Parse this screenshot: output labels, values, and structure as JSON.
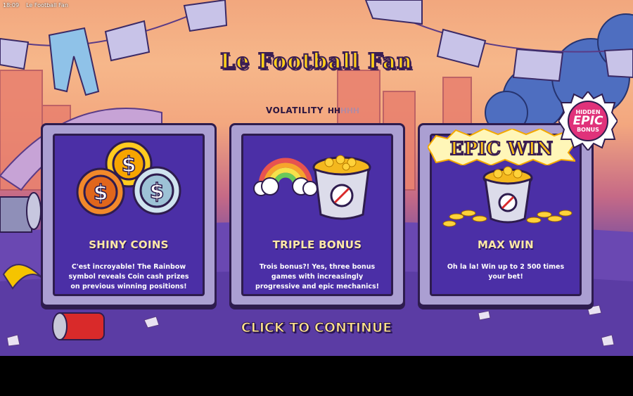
{
  "window": {
    "clock": "18:09",
    "title": "Le Football Fan"
  },
  "game": {
    "title": "Le Football Fan"
  },
  "volatility": {
    "label": "VOLATILITY",
    "level": 2,
    "max": 5,
    "icon": "H"
  },
  "features": [
    {
      "title": "SHINY COINS",
      "description": "C'est incroyable! The Rainbow symbol reveals Coin cash prizes on previous winning positions!",
      "icon": "coins-icon"
    },
    {
      "title": "TRIPLE BONUS",
      "description": "Trois bonus?! Yes, three bonus games with increasingly progressive and epic mechanics!",
      "icon": "rainbow-bucket-icon"
    },
    {
      "title": "MAX WIN",
      "description": "Oh la la! Win up to 2 500 times your bet!",
      "icon": "gold-bucket-icon",
      "banner": "EPIC WIN"
    }
  ],
  "badge": {
    "line1": "HIDDEN",
    "line2": "EPIC",
    "line3": "BONUS"
  },
  "continue_label": "CLICK TO CONTINUE",
  "colors": {
    "card_frame": "#ab9fd2",
    "card_inner": "#4b2fa6",
    "title_gold": "#ffcf1a",
    "badge": "#e0327a"
  }
}
